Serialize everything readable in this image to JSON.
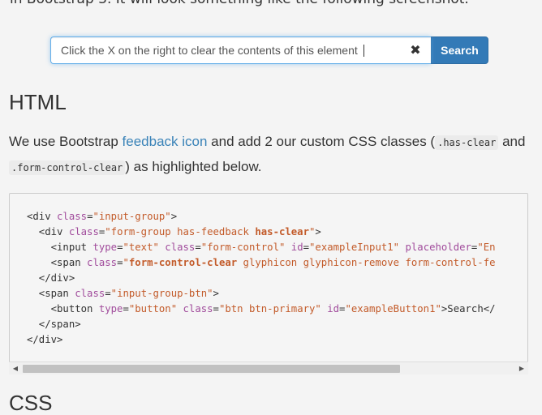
{
  "intro_cut_text": "in Bootstrap 3. It will look something like the following screenshot.",
  "demo": {
    "input_value": "Click the X on the right to clear the contents of this element",
    "clear_glyph": "✖",
    "search_label": "Search"
  },
  "section": {
    "heading": "HTML",
    "text_before_link": "We use Bootstrap ",
    "link_text": "feedback icon",
    "text_after_link": " and add 2 our custom CSS classes (",
    "code1": ".has-clear",
    "text_and": " and ",
    "code2": ".form-control-clear",
    "text_end": ") as highlighted below."
  },
  "code_lines": [
    "<div class=\"input-group\">",
    "  <div class=\"form-group has-feedback has-clear\">",
    "    <input type=\"text\" class=\"form-control\" id=\"exampleInput1\" placeholder=\"En",
    "    <span class=\"form-control-clear glyphicon glyphicon-remove form-control-fe",
    "  </div>",
    "  <span class=\"input-group-btn\">",
    "    <button type=\"button\" class=\"btn btn-primary\" id=\"exampleButton1\">Search</",
    "  </span>",
    "</div>"
  ],
  "scrollbar": {
    "left_arrow": "◀",
    "right_arrow": "▶"
  },
  "next_heading_cut": "CSS"
}
